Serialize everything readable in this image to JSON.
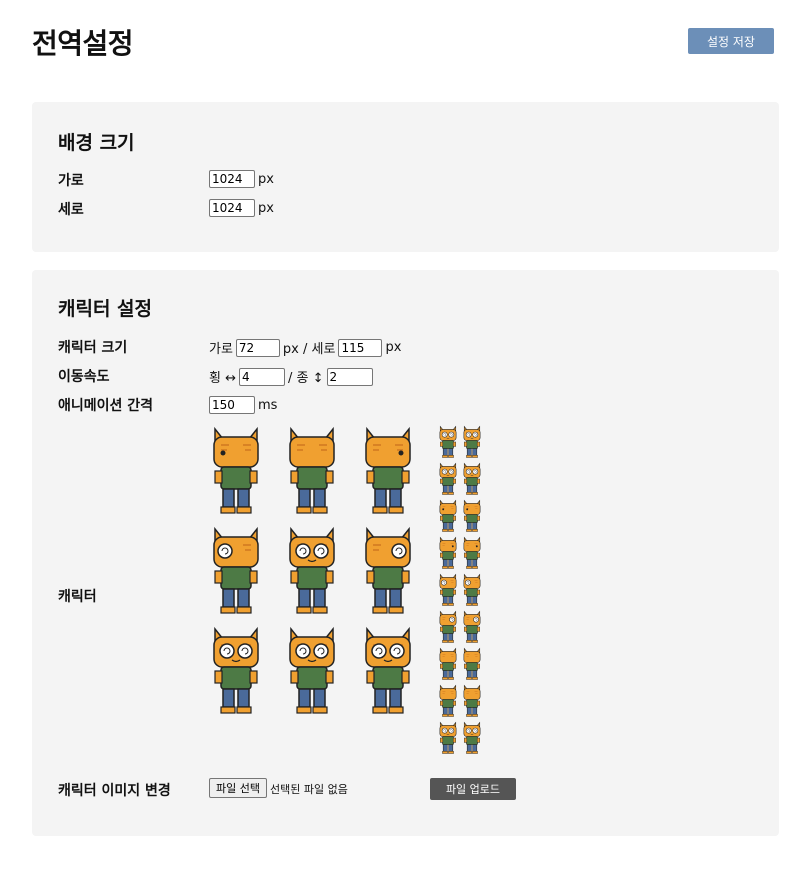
{
  "page": {
    "title": "전역설정",
    "save_label": "설정 저장"
  },
  "background": {
    "title": "배경 크기",
    "width_label": "가로",
    "width_value": "1024",
    "width_unit": "px",
    "height_label": "세로",
    "height_value": "1024",
    "height_unit": "px"
  },
  "character": {
    "title": "캐릭터 설정",
    "size_label": "캐릭터 크기",
    "size_w_prefix": "가로",
    "size_w_value": "72",
    "size_w_unit": "px / 세로",
    "size_h_value": "115",
    "size_h_unit": "px",
    "speed_label": "이동속도",
    "speed_h_prefix": "횡 ↔",
    "speed_h_value": "4",
    "speed_v_prefix": "/ 종 ↕",
    "speed_v_value": "2",
    "anim_label": "애니메이션 간격",
    "anim_value": "150",
    "anim_unit": "ms",
    "sprite_label": "캐릭터",
    "image_change_label": "캐릭터 이미지 변경",
    "file_button": "파일 선택",
    "file_status": "선택된 파일 없음",
    "upload_button": "파일 업로드"
  },
  "colors": {
    "save_button": "#6c8fb8",
    "upload_button": "#555555",
    "card_bg": "#f4f4f4",
    "cat_orange": "#f0a030",
    "shirt_green": "#4d7a45",
    "pants_blue": "#4a6a9a"
  }
}
